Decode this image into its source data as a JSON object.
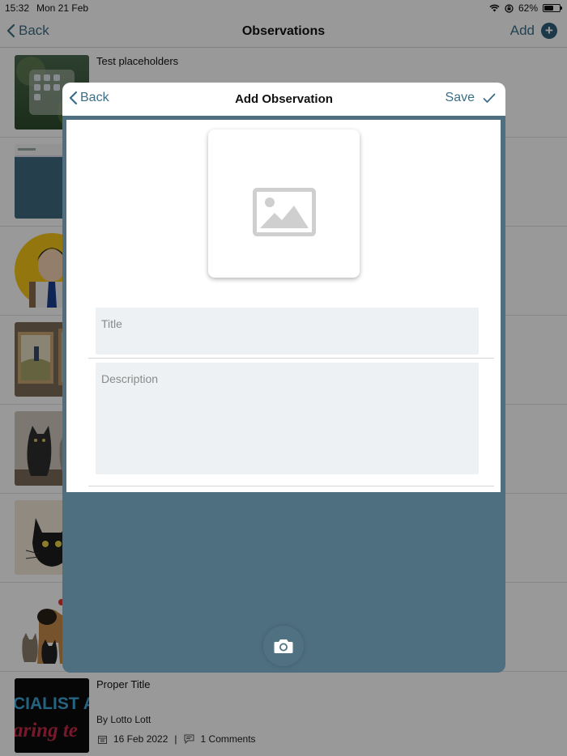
{
  "status_bar": {
    "time": "15:32",
    "date": "Mon 21 Feb",
    "battery": "62%",
    "battery_level": 0.62
  },
  "nav": {
    "back_label": "Back",
    "title": "Observations",
    "add_label": "Add"
  },
  "list": [
    {
      "title": "Test placeholders",
      "thumb": "ipad-homescreen"
    },
    {
      "title": "",
      "thumb": "screenshot"
    },
    {
      "title": "",
      "thumb": "cartoon-person"
    },
    {
      "title": "",
      "thumb": "framed-painting"
    },
    {
      "title": "",
      "thumb": "cats-photo"
    },
    {
      "title": "",
      "thumb": "cat-drawing"
    },
    {
      "title": "",
      "thumb": "dogs-and-cats"
    },
    {
      "title": "Proper Title",
      "thumb": "specialist-banner",
      "thumb_text_1": "CIALIST AL",
      "thumb_text_2": "aring te",
      "author": "By Lotto Lott",
      "date": "16 Feb 2022",
      "separator": "|",
      "comments": "1 Comments"
    }
  ],
  "modal": {
    "back_label": "Back",
    "title": "Add Observation",
    "save_label": "Save",
    "image_placeholder_icon": "image-placeholder-icon",
    "title_placeholder": "Title",
    "description_placeholder": "Description",
    "camera_icon": "camera-icon"
  },
  "colors": {
    "accent": "#3c6e86",
    "modal_bg": "#4d6f80",
    "field_bg": "#edf1f3",
    "dark": "#2e6078"
  }
}
